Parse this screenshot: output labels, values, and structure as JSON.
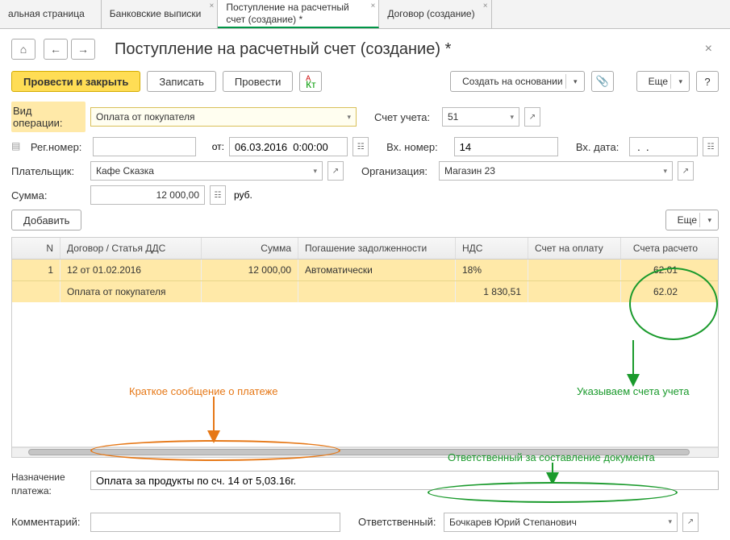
{
  "tabs": [
    {
      "label": "альная страница"
    },
    {
      "label": "Банковские выписки"
    },
    {
      "label": "Поступление на расчетный счет (создание) *",
      "active": true
    },
    {
      "label": "Договор (создание)"
    }
  ],
  "title": "Поступление на расчетный счет (создание) *",
  "toolbar": {
    "post_close": "Провести и закрыть",
    "save": "Записать",
    "post": "Провести",
    "create_based": "Создать на основании",
    "more": "Еще"
  },
  "form": {
    "op_type_label": "Вид операции:",
    "op_type_value": "Оплата от покупателя",
    "account_label": "Счет учета:",
    "account_value": "51",
    "reg_num_label": "Рег.номер:",
    "reg_num_value": "",
    "from_label": "от:",
    "from_value": "06.03.2016  0:00:00",
    "ext_num_label": "Вх. номер:",
    "ext_num_value": "14",
    "ext_date_label": "Вх. дата:",
    "ext_date_value": " .  .",
    "payer_label": "Плательщик:",
    "payer_value": "Кафе Сказка",
    "org_label": "Организация:",
    "org_value": "Магазин 23",
    "sum_label": "Сумма:",
    "sum_value": "12 000,00",
    "sum_unit": "руб.",
    "add_btn": "Добавить",
    "more_btn": "Еще"
  },
  "table": {
    "headers": {
      "n": "N",
      "contract": "Договор / Статья ДДС",
      "sum": "Сумма",
      "repay": "Погашение задолженности",
      "vat": "НДС",
      "invoice": "Счет на оплату",
      "settle": "Счета расчето"
    },
    "row1": {
      "n": "1",
      "contract": "12 от 01.02.2016",
      "sum": "12 000,00",
      "repay": "Автоматически",
      "vat": "18%",
      "settle": "62.01"
    },
    "row2": {
      "contract": "Оплата от покупателя",
      "vat": "1 830,51",
      "settle": "62.02"
    }
  },
  "footer": {
    "purpose_label": "Назначение платежа:",
    "purpose_value": "Оплата за продукты по сч. 14 от 5,03.16г.",
    "comment_label": "Комментарий:",
    "comment_value": "",
    "resp_label": "Ответственный:",
    "resp_value": "Бочкарев Юрий Степанович"
  },
  "annotations": {
    "orange1": "Краткое сообщение о платеже",
    "green1": "Указываем счета учета",
    "green2": "Ответственный за составление документа"
  }
}
